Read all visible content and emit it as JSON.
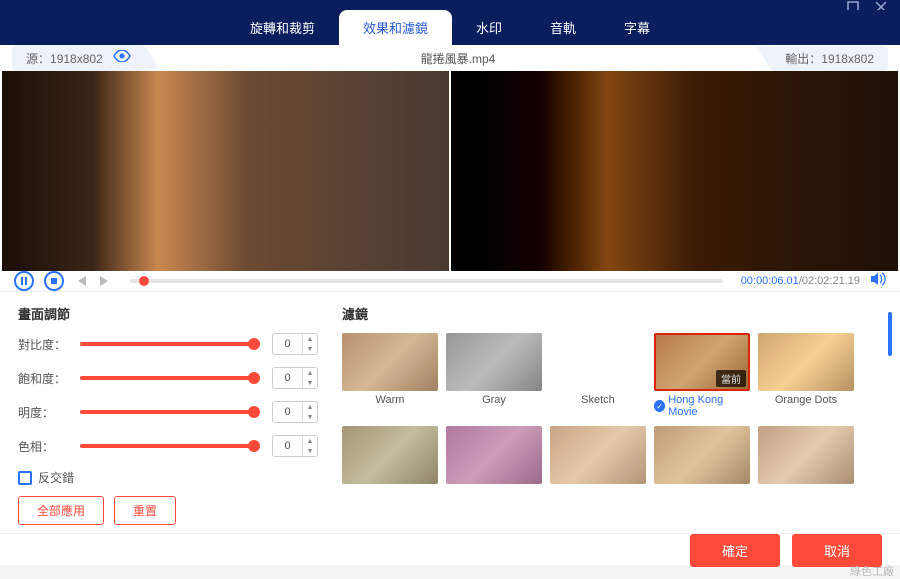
{
  "window": {
    "maximize_icon": "maximize",
    "close_icon": "close"
  },
  "tabs": [
    {
      "label": "旋轉和裁剪"
    },
    {
      "label": "效果和濾鏡",
      "active": true
    },
    {
      "label": "水印"
    },
    {
      "label": "音軌"
    },
    {
      "label": "字幕"
    }
  ],
  "infobar": {
    "source_label": "源：",
    "source_res": "1918x802",
    "filename": "龍捲風暴.mp4",
    "output_label": "輸出：",
    "output_res": "1918x802"
  },
  "playback": {
    "current": "00:00:06.01",
    "separator": "/",
    "duration": "02:02:21.19"
  },
  "adjust": {
    "title": "畫面調節",
    "rows": [
      {
        "label": "對比度：",
        "value": "0"
      },
      {
        "label": "飽和度：",
        "value": "0"
      },
      {
        "label": "明度：",
        "value": "0"
      },
      {
        "label": "色相：",
        "value": "0"
      }
    ],
    "deinterlace": "反交錯",
    "apply_all": "全部應用",
    "reset": "重置"
  },
  "filters": {
    "title": "濾鏡",
    "items": [
      {
        "label": "Warm",
        "cls": ""
      },
      {
        "label": "Gray",
        "cls": "gray"
      },
      {
        "label": "Sketch",
        "cls": "sketch"
      },
      {
        "label": "Hong Kong Movie",
        "cls": "hk",
        "selected": true,
        "badge": "當前"
      },
      {
        "label": "Orange Dots",
        "cls": "orange"
      },
      {
        "label": "",
        "cls": "r2a"
      },
      {
        "label": "",
        "cls": "r2b"
      },
      {
        "label": "",
        "cls": "r2c"
      },
      {
        "label": "",
        "cls": "r2d"
      },
      {
        "label": "",
        "cls": "r2e"
      }
    ]
  },
  "footer": {
    "ok": "確定",
    "cancel": "取消"
  },
  "watermark": "綠色工廠"
}
